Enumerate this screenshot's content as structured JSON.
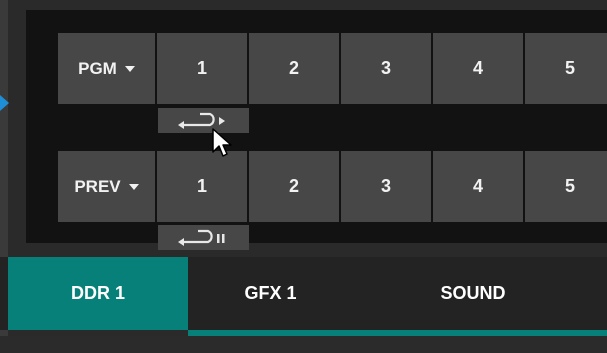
{
  "colors": {
    "accent": "#07807a",
    "marker": "#1e8fd6",
    "button_bg": "#474747",
    "panel_bg": "#121212"
  },
  "pgm_row": {
    "label": "PGM",
    "sources": [
      "1",
      "2",
      "3",
      "4",
      "5"
    ],
    "loop_icon": "loop-play-icon"
  },
  "prev_row": {
    "label": "PREV",
    "sources": [
      "1",
      "2",
      "3",
      "4",
      "5"
    ],
    "loop_icon": "loop-pause-icon"
  },
  "tabs": [
    {
      "label": "DDR 1",
      "active": true
    },
    {
      "label": "GFX 1",
      "active": false
    },
    {
      "label": "SOUND",
      "active": false
    }
  ]
}
